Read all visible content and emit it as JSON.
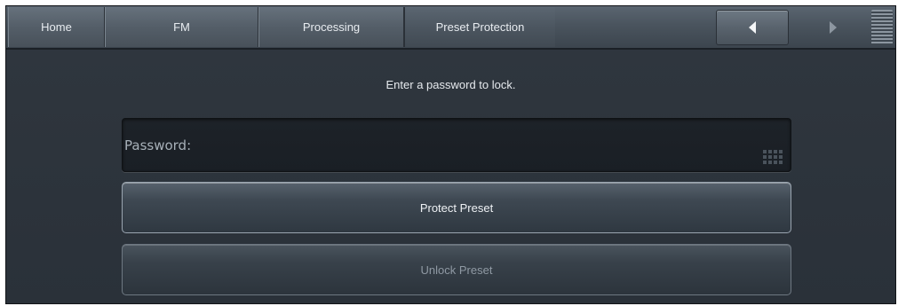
{
  "topbar": {
    "tabs": [
      {
        "label": "Home"
      },
      {
        "label": "FM"
      },
      {
        "label": "Processing"
      }
    ],
    "current_page": "Preset Protection",
    "nav": {
      "prev_icon": "left-triangle-icon",
      "next_icon": "right-triangle-icon",
      "menu_icon": "menu-lines-icon"
    }
  },
  "main": {
    "prompt": "Enter a password to lock.",
    "password_field": {
      "label": "Password:",
      "value": "",
      "icon": "keypad-icon"
    },
    "protect_button": "Protect Preset",
    "unlock_button": "Unlock Preset"
  },
  "colors": {
    "background": "#2a3139",
    "topbar": "#4a545e",
    "text": "#e6eaee",
    "disabled_text": "#8f99a3"
  }
}
